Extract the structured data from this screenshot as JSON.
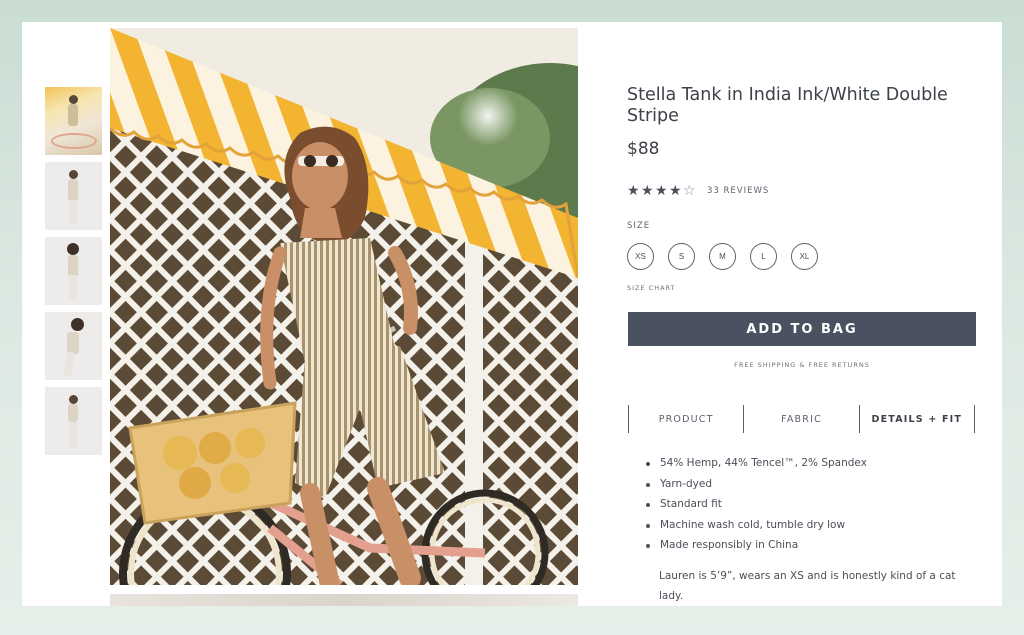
{
  "product": {
    "title": "Stella Tank in India Ink/White Double Stripe",
    "price": "$88",
    "rating": 4,
    "rating_max": 5,
    "reviews_label": "33 REVIEWS"
  },
  "size_section": {
    "label": "SIZE",
    "options": [
      "XS",
      "S",
      "M",
      "L",
      "XL"
    ],
    "size_chart_label": "SIZE CHART"
  },
  "cta": {
    "add_to_bag": "ADD TO BAG",
    "shipping_note": "FREE SHIPPING & FREE RETURNS"
  },
  "tabs": [
    {
      "label": "PRODUCT",
      "active": false
    },
    {
      "label": "FABRIC",
      "active": false
    },
    {
      "label": "DETAILS + FIT",
      "active": true
    }
  ],
  "details": {
    "bullets": [
      "54% Hemp, 44% Tencel™, 2% Spandex",
      "Yarn-dyed",
      "Standard fit",
      "Machine wash cold, tumble dry low",
      "Made responsibly in China"
    ],
    "model_note": "Lauren is 5’9”, wears an XS and is honestly kind of a cat lady."
  },
  "gallery": {
    "thumbnail_count": 5
  },
  "colors": {
    "button_bg": "#4a5161",
    "text": "#3d4149",
    "awning_yellow": "#f2b431",
    "bike_pink": "#e3a08e"
  }
}
